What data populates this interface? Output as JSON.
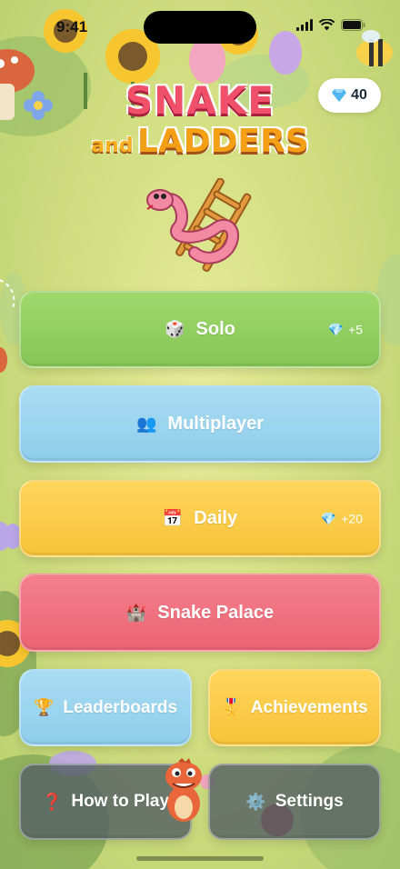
{
  "status_bar": {
    "time": "9:41"
  },
  "gems": {
    "icon": "diamond-icon",
    "count": "40"
  },
  "title": {
    "line1": "SNAKE",
    "and": "and",
    "line2": "LADDERS"
  },
  "menu": {
    "solo": {
      "icon": "dice-icon",
      "glyph": "🎲",
      "label": "Solo",
      "reward": "+5",
      "reward_icon": "💎"
    },
    "multiplayer": {
      "icon": "people-icon",
      "glyph": "👥",
      "label": "Multiplayer"
    },
    "daily": {
      "icon": "calendar-icon",
      "glyph": "📅",
      "label": "Daily",
      "reward": "+20",
      "reward_icon": "💎"
    },
    "palace": {
      "icon": "castle-icon",
      "glyph": "🏰",
      "label": "Snake Palace"
    },
    "leaderboards": {
      "icon": "trophy-icon",
      "glyph": "🏆",
      "label": "Leaderboards"
    },
    "achievements": {
      "icon": "medal-icon",
      "glyph": "🎖️",
      "label": "Achievements"
    },
    "how_to_play": {
      "icon": "question-icon",
      "glyph": "❓",
      "label": "How to Play"
    },
    "settings": {
      "icon": "gear-icon",
      "glyph": "⚙️",
      "label": "Settings"
    }
  },
  "colors": {
    "solo": "#8ccb5c",
    "multiplayer": "#98d2ec",
    "daily": "#f8c842",
    "palace": "#ee6b7a",
    "secondary": "#56606a"
  }
}
